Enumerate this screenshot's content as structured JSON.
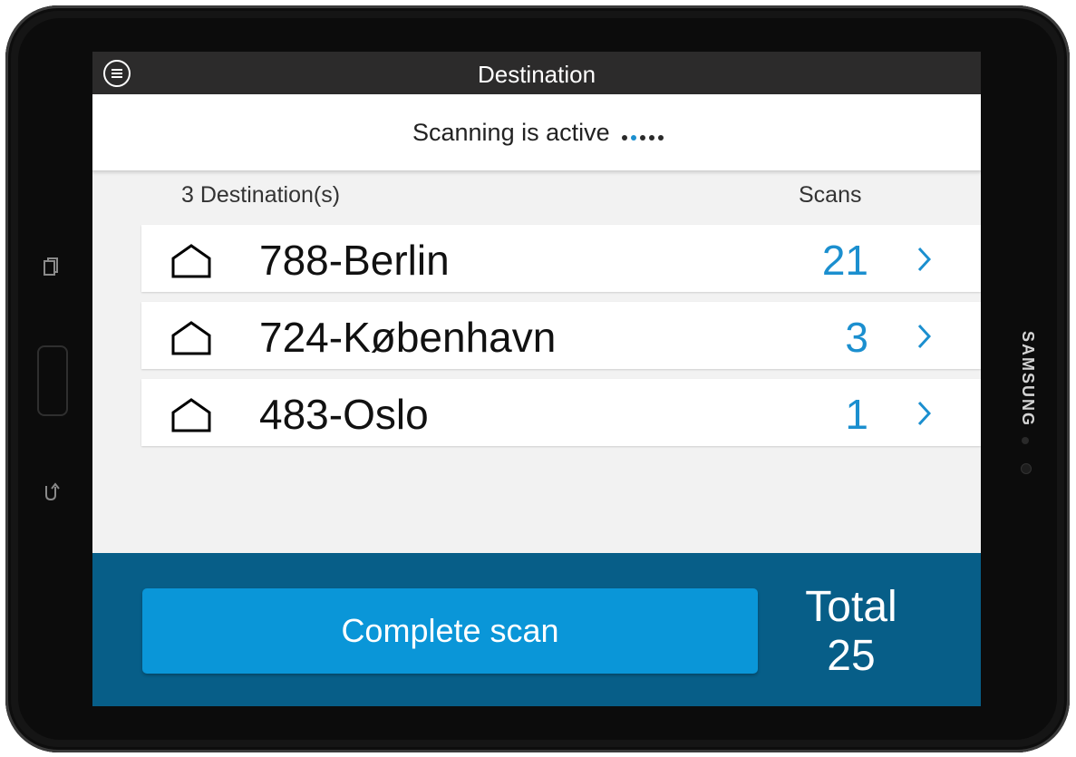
{
  "header": {
    "title": "Destination"
  },
  "status": {
    "text": "Scanning is active",
    "active_dot_index": 1,
    "dot_count": 5
  },
  "list": {
    "count_label": "3 Destination(s)",
    "scans_label": "Scans",
    "rows": [
      {
        "name": "788-Berlin",
        "scans": "21"
      },
      {
        "name": "724-København",
        "scans": "3"
      },
      {
        "name": "483-Oslo",
        "scans": "1"
      }
    ]
  },
  "footer": {
    "complete_label": "Complete scan",
    "total_label": "Total",
    "total_value": "25"
  },
  "device": {
    "brand": "SAMSUNG"
  },
  "icons": {
    "menu": "menu-icon",
    "destination": "home-icon",
    "open": "chevron-right-icon"
  },
  "colors": {
    "accent": "#1b8fcf",
    "button": "#0a96d8",
    "footer": "#075e88",
    "topbar": "#2c2b2b"
  }
}
